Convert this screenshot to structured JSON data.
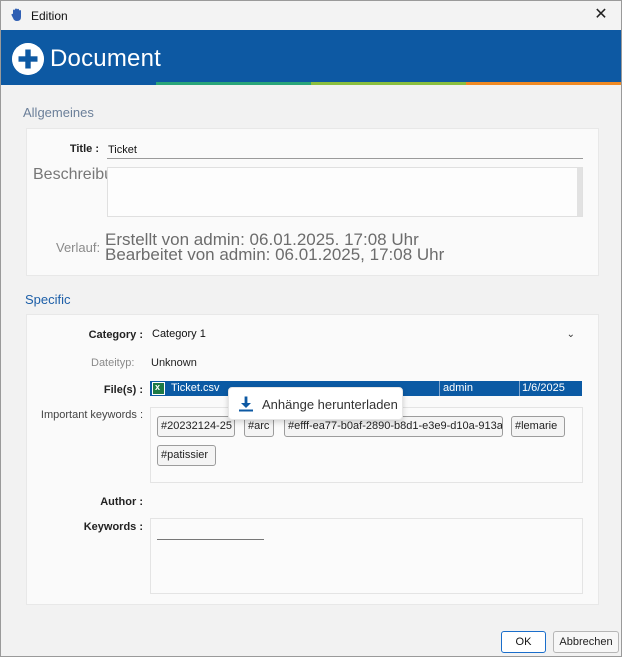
{
  "window": {
    "title": "Edition",
    "close_glyph": "✕"
  },
  "header": {
    "title": "Document",
    "icon": "plus-circle-icon",
    "color": "#0d59a3",
    "stripe_colors": [
      "#0d59a3",
      "#2aa57a",
      "#8bbf3f",
      "#f08a24"
    ]
  },
  "general": {
    "heading": "Allgemeines",
    "title_label": "Title :",
    "title_value": "Ticket",
    "description_label": "Beschreibung:",
    "history_label": "Verlauf:",
    "history_created": "Erstellt von admin: 06.01.2025. 17:08 Uhr",
    "history_modified": "Bearbeitet von admin: 06.01.2025, 17:08 Uhr"
  },
  "specific": {
    "heading": "Specific",
    "category_label": "Category :",
    "category_value": "Category 1",
    "filetype_label": "Dateityp:",
    "filetype_value": "Unknown",
    "files_label": "File(s) :",
    "file": {
      "name": "Ticket.csv",
      "user": "admin",
      "date": "1/6/2025",
      "icon": "excel-file-icon"
    },
    "download_label": "Anhänge herunterladen",
    "important_keywords_label": "Important keywords :",
    "tags": [
      "#20232124-25",
      "#arc",
      "#efff-ea77-b0af-2890-b8d1-e3e9-d10a-913a",
      "#lemarie",
      "#patissier"
    ],
    "author_label": "Author :",
    "keywords_label": "Keywords :"
  },
  "footer": {
    "ok_label": "OK",
    "cancel_label": "Abbrechen"
  },
  "colors": {
    "accent": "#0d59a3",
    "section_heading_general": "#6b7f99",
    "section_heading_specific": "#1d5fa8",
    "selection": "#0b5aa4"
  }
}
